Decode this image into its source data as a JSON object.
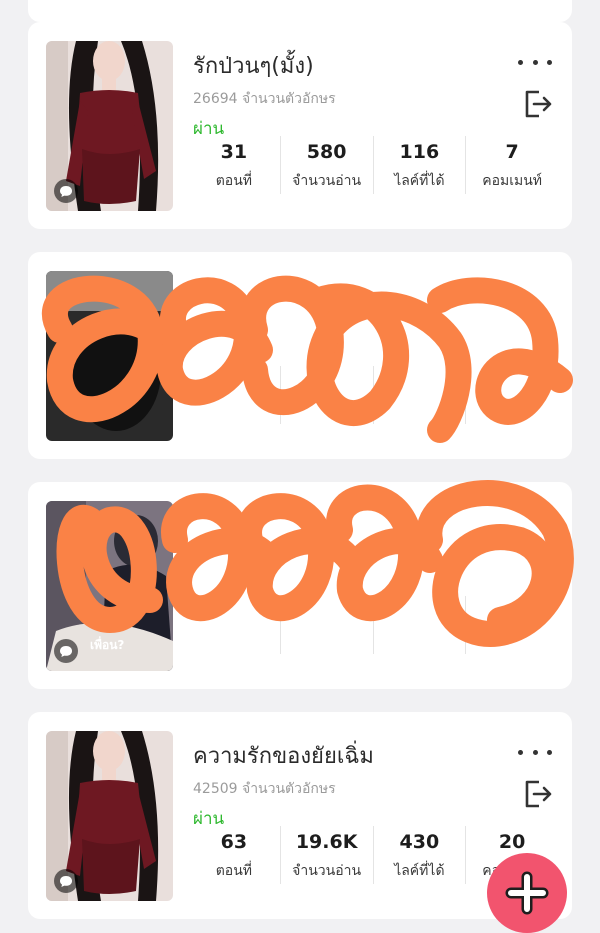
{
  "works": [
    {
      "title": "รักป่วนๆ(มั้ง)",
      "char_count": "26694 จำนวนตัวอักษร",
      "status": "ผ่าน",
      "stats": [
        {
          "value": "31",
          "label": "ตอนที่"
        },
        {
          "value": "580",
          "label": "จำนวนอ่าน"
        },
        {
          "value": "116",
          "label": "ไลค์ที่ได้"
        },
        {
          "value": "7",
          "label": "คอมเมนท์"
        }
      ]
    },
    {
      "title": "",
      "char_count": "",
      "status": "",
      "stats": [
        {
          "value": "",
          "label": ""
        },
        {
          "value": "",
          "label": ""
        },
        {
          "value": "",
          "label": ""
        },
        {
          "value": "",
          "label": ""
        }
      ]
    },
    {
      "title": "",
      "cover_caption": "เพื่อน?",
      "char_count": "",
      "status": "",
      "stats": [
        {
          "value": "",
          "label": ""
        },
        {
          "value": "",
          "label": ""
        },
        {
          "value": "",
          "label": ""
        },
        {
          "value": "",
          "label": ""
        }
      ]
    },
    {
      "title": "ความรักของยัยเฉิ่ม",
      "char_count": "42509 จำนวนตัวอักษร",
      "status": "ผ่าน",
      "stats": [
        {
          "value": "63",
          "label": "ตอนที่"
        },
        {
          "value": "19.6K",
          "label": "จำนวนอ่าน"
        },
        {
          "value": "430",
          "label": "ไลค์ที่ได้"
        },
        {
          "value": "20",
          "label": "คอมเมนท์"
        }
      ]
    }
  ],
  "colors": {
    "status_green": "#2eb82e",
    "fab_pink": "#f2546e",
    "scribble_orange": "#fa8246",
    "dress_red": "#6e1822"
  },
  "icons": {
    "more": "more-dots-icon",
    "exit": "exit-icon",
    "comment": "comment-bubble-icon",
    "add": "plus-icon"
  }
}
